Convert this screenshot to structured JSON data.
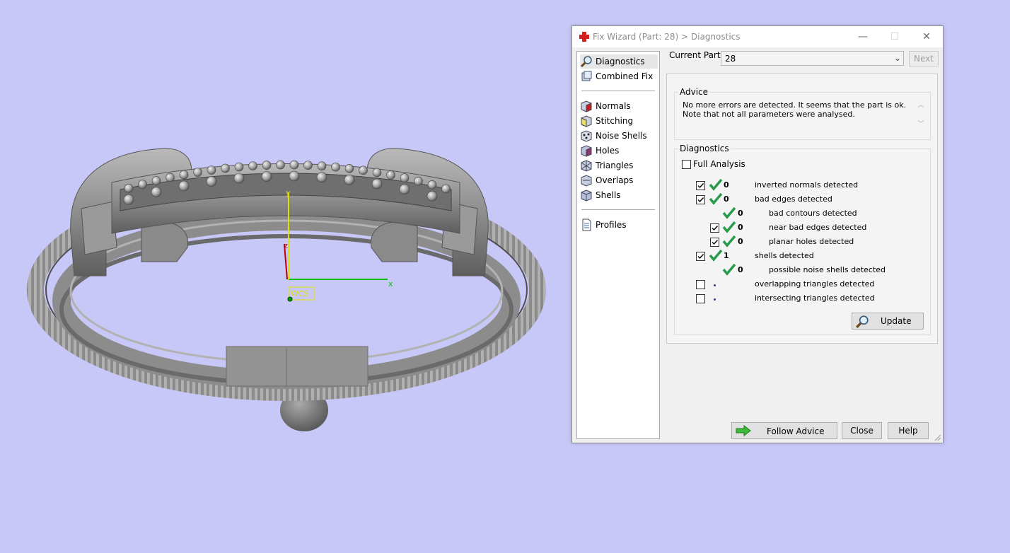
{
  "window": {
    "title": "Fix Wizard (Part: 28) > Diagnostics",
    "minimize": "—",
    "maximize": "☐",
    "close": "✕"
  },
  "nav": {
    "items": [
      {
        "label": "Diagnostics",
        "icon": "magnifier-icon",
        "selected": true
      },
      {
        "label": "Combined Fix",
        "icon": "combined-fix-icon"
      },
      {
        "label": "Normals",
        "icon": "normals-cube-icon"
      },
      {
        "label": "Stitching",
        "icon": "stitching-cube-icon"
      },
      {
        "label": "Noise Shells",
        "icon": "noise-shells-icon"
      },
      {
        "label": "Holes",
        "icon": "holes-cube-icon"
      },
      {
        "label": "Triangles",
        "icon": "triangles-cube-icon"
      },
      {
        "label": "Overlaps",
        "icon": "overlaps-cube-icon"
      },
      {
        "label": "Shells",
        "icon": "shells-cube-icon"
      },
      {
        "label": "Profiles",
        "icon": "profiles-document-icon"
      }
    ]
  },
  "current_part": {
    "label": "Current Part:",
    "value": "28",
    "next": "Next"
  },
  "advice": {
    "title": "Advice",
    "text": "No more errors are detected. It seems that the part is ok. Note that not all parameters were analysed."
  },
  "diagnostics": {
    "title": "Diagnostics",
    "full_analysis": "Full Analysis",
    "full_analysis_checked": false,
    "rows": [
      {
        "checked": true,
        "status": "ok",
        "count": "0",
        "label": "inverted normals detected"
      },
      {
        "checked": true,
        "status": "ok",
        "count": "0",
        "label": "bad edges detected"
      },
      {
        "checkbox": false,
        "status": "ok",
        "count": "0",
        "label": "bad contours detected"
      },
      {
        "checked": true,
        "status": "ok",
        "count": "0",
        "label": "near bad edges detected"
      },
      {
        "checked": true,
        "status": "ok",
        "count": "0",
        "label": "planar holes detected"
      },
      {
        "checked": true,
        "status": "ok",
        "count": "1",
        "label": "shells detected"
      },
      {
        "checkbox": false,
        "status": "ok",
        "count": "0",
        "label": "possible noise shells detected"
      },
      {
        "checked": false,
        "status": "pending",
        "count": "",
        "label": "overlapping triangles detected"
      },
      {
        "checked": false,
        "status": "pending",
        "count": "",
        "label": "intersecting triangles detected"
      }
    ],
    "update": "Update"
  },
  "footer": {
    "follow_advice": "Follow Advice",
    "close": "Close",
    "help": "Help"
  },
  "viewport": {
    "axis_x": "x",
    "axis_y": "y",
    "axis_z": "z",
    "origin_label": "WCS",
    "colors": {
      "background": "#c8c8f8",
      "model": "#8e8e8e",
      "axis_x": "#00c000",
      "axis_y": "#e0e000",
      "axis_z": "#c00000"
    }
  }
}
